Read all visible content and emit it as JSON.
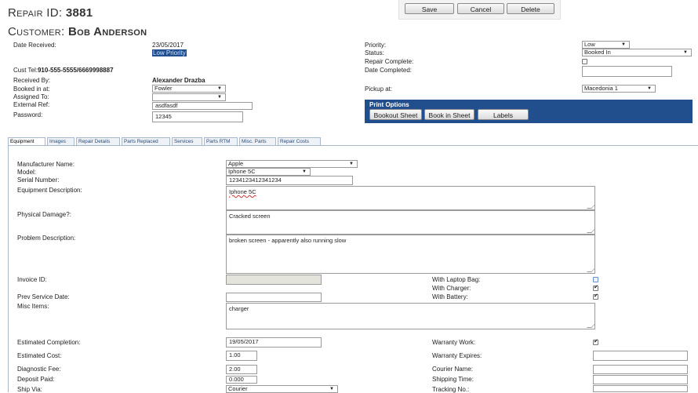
{
  "header": {
    "repair_id_label": "Repair ID:",
    "repair_id_value": "3881",
    "customer_label": "Customer:",
    "customer_value": "Bob Anderson"
  },
  "toolbar": {
    "save_label": "Save",
    "cancel_label": "Cancel",
    "delete_label": "Delete"
  },
  "details": {
    "date_received_label": "Date Received:",
    "date_received_value": "23/05/2017",
    "priority_badge": "Low Priority",
    "cust_tel_label": "Cust Tel:",
    "cust_tel_value": "910-555-5555/6669998887",
    "received_by_label": "Received By:",
    "received_by_value": "Alexander Drazba",
    "booked_in_label": "Booked in at:",
    "booked_in_value": "Fowler",
    "assigned_to_label": "Assigned To:",
    "assigned_to_value": "",
    "external_ref_label": "External Ref:",
    "external_ref_value": "asdfasdf",
    "password_label": "Password:",
    "password_value": "12345",
    "priority_label": "Priority:",
    "priority_value": "Low",
    "status_label": "Status:",
    "status_value": "Booked In",
    "repair_complete_label": "Repair Complete:",
    "repair_complete_checked": false,
    "date_completed_label": "Date Completed:",
    "date_completed_value": "",
    "pickup_label": "Pickup at:",
    "pickup_value": "Macedonia 1"
  },
  "print_options": {
    "title": "Print Options",
    "bookout_label": "Bookout Sheet",
    "bookin_label": "Book in Sheet",
    "labels_label": "Labels"
  },
  "tabs": [
    "Equipment",
    "Images",
    "Repair Details",
    "Parts Replaced",
    "Services",
    "Parts RTM",
    "Misc. Parts",
    "Repair Costs"
  ],
  "equipment": {
    "manufacturer_label": "Manufacturer Name:",
    "manufacturer_value": "Apple",
    "model_label": "Model:",
    "model_value": "Iphone 5C",
    "serial_label": "Serial Number:",
    "serial_value": "1234123412341234",
    "description_label": "Equipment Description:",
    "description_value": "Iphone 5C",
    "damage_label": "Physical Damage?:",
    "damage_value": "Cracked screen",
    "problem_label": "Problem Description:",
    "problem_value": "broken screen - apparently also running slow",
    "invoice_label": "Invoice ID:",
    "invoice_value": "",
    "prev_service_label": "Prev Service Date:",
    "prev_service_value": "",
    "misc_items_label": "Misc Items:",
    "misc_items_value": "charger",
    "laptop_bag_label": "With Laptop Bag:",
    "charger_label": "With Charger:",
    "battery_label": "With Battery:",
    "est_completion_label": "Estimated Completion:",
    "est_completion_value": "19/05/2017",
    "est_cost_label": "Estimated Cost:",
    "est_cost_value": "1.00",
    "diag_fee_label": "Diagnostic Fee:",
    "diag_fee_value": "2.00",
    "deposit_label": "Deposit Paid:",
    "deposit_value": "0.000",
    "ship_via_label": "Ship Via:",
    "ship_via_value": "Courier",
    "warranty_work_label": "Warranty Work:",
    "warranty_expires_label": "Warranty Expires:",
    "courier_name_label": "Courier Name:",
    "shipping_time_label": "Shipping Time:",
    "tracking_label": "Tracking No.:"
  },
  "colors": {
    "print_panel_bg": "#214f8e",
    "tab_text": "#2a4a7a"
  }
}
